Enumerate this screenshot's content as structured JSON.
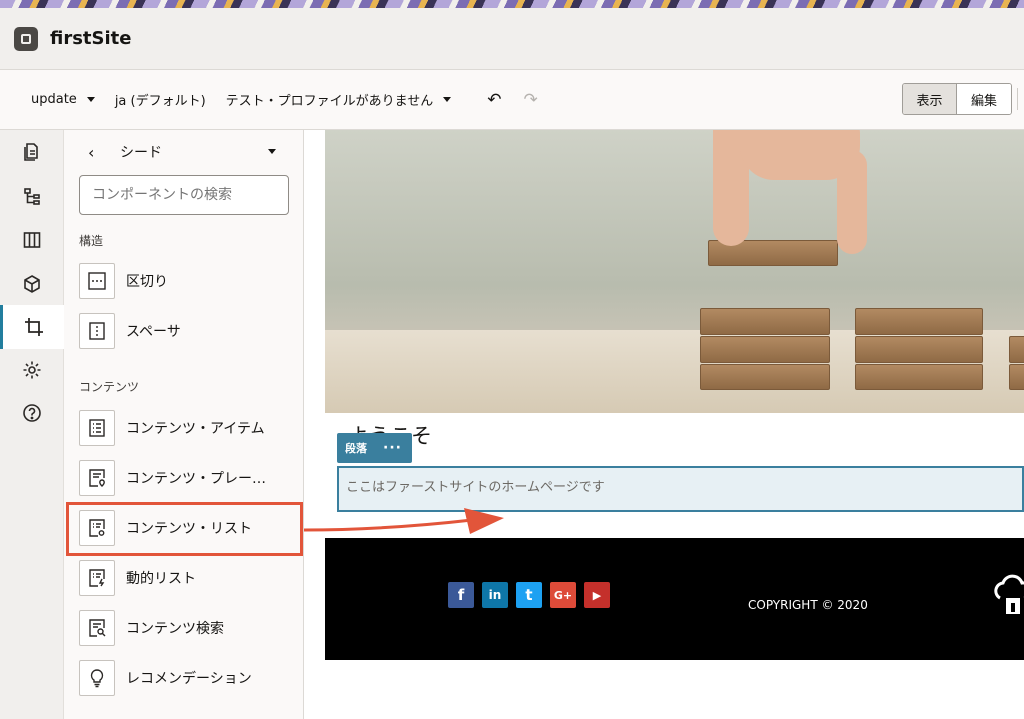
{
  "header": {
    "title": "firstSite"
  },
  "toolbar": {
    "update": "update",
    "language": "ja (デフォルト)",
    "profile": "テスト・プロファイルがありません",
    "view_label": "表示",
    "edit_label": "編集"
  },
  "rail": {
    "items": [
      "pages-icon",
      "structure-icon",
      "layout-icon",
      "assets-icon",
      "components-icon",
      "settings-icon",
      "help-icon"
    ],
    "active": "components-icon"
  },
  "panel": {
    "title": "シード",
    "search_placeholder": "コンポーネントの検索",
    "structure_label": "構造",
    "structure_items": [
      "区切り",
      "スペーサ"
    ],
    "content_label": "コンテンツ",
    "content_items": [
      "コンテンツ・アイテム",
      "コンテンツ・プレー…",
      "コンテンツ・リスト",
      "動的リスト",
      "コンテンツ検索",
      "レコメンデーション"
    ],
    "highlighted": "コンテンツ・リスト"
  },
  "page": {
    "welcome": "ようこそ",
    "paragraph_tag": "段落",
    "paragraph_menu": "···",
    "paragraph_text": "ここはファーストサイトのホームページです",
    "social": [
      "f",
      "in",
      "t",
      "G+",
      "▶"
    ],
    "copyright": "COPYRIGHT © 2020"
  },
  "colors": {
    "accent": "#3a7f9e",
    "annotation": "#e2553a"
  }
}
